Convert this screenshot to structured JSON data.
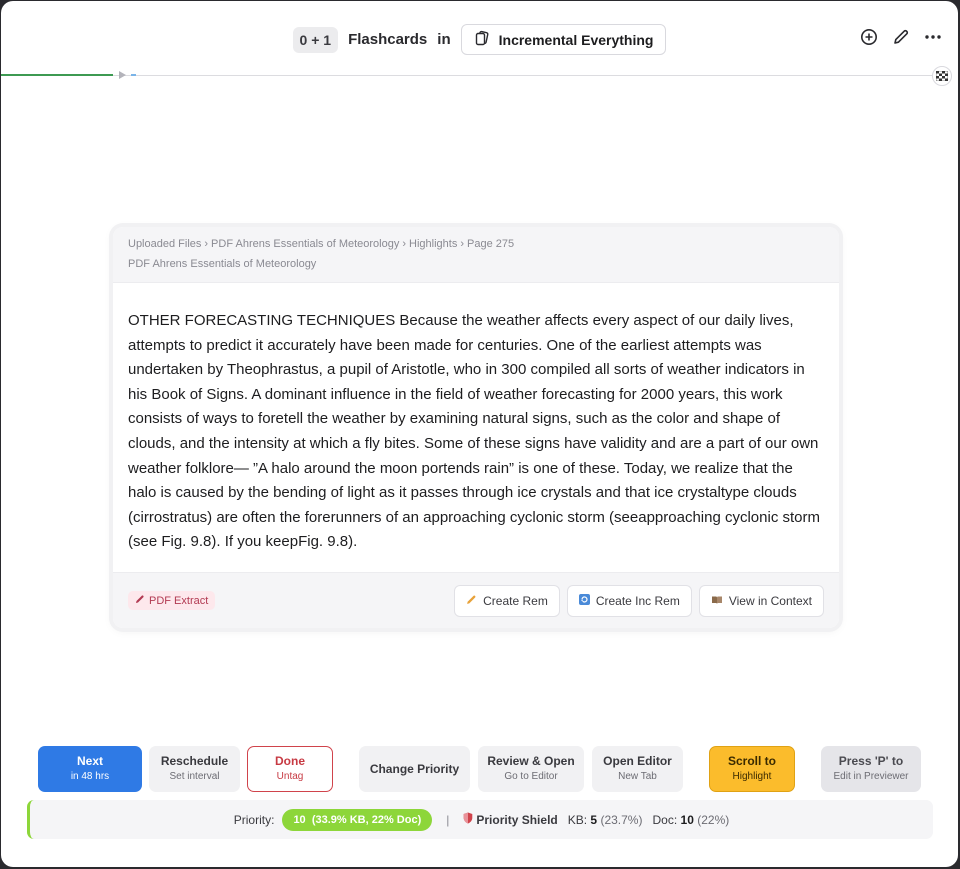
{
  "header": {
    "count": "0 + 1",
    "title": "Flashcards",
    "in_text": "in",
    "deck_name": "Incremental Everything",
    "actions": [
      "add-icon",
      "edit-icon",
      "more-icon"
    ]
  },
  "progress": {
    "completed_fraction": 0.12
  },
  "card": {
    "breadcrumb": [
      "Uploaded Files",
      "PDF Ahrens Essentials of Meteorology",
      "Highlights",
      "Page 275"
    ],
    "source": "PDF Ahrens Essentials of Meteorology",
    "body": "OTHER FORECASTING TECHNIQUES Because the weather affects every aspect of our daily lives, attempts to predict it accurately have been made for centuries. One of the earliest attempts was undertaken by Theophrastus, a pupil of Aristotle, who in 300    compiled all sorts of weather indicators in his Book of Signs. A dominant influence in the field of weather forecasting for 2000 years, this work consists of ways to foretell the weather by examining natural signs, such as the color and shape of clouds, and the intensity at which a fly bites. Some of these signs have validity and are a part of our own weather folklore— ”A halo around the moon portends rain” is one of these. Today, we realize that the halo is caused by the bending of light as it passes through ice crystals and that ice crystaltype clouds (cirrostratus) are often the forerunners of an approaching cyclonic storm (seeapproaching cyclonic storm (see Fig. 9.8). If you keepFig. 9.8).",
    "tag": "PDF Extract",
    "buttons": {
      "create_rem": "Create Rem",
      "create_inc_rem": "Create Inc Rem",
      "view_in_context": "View in Context"
    }
  },
  "actions": {
    "next": {
      "title": "Next",
      "sub": "in 48 hrs"
    },
    "reschedule": {
      "title": "Reschedule",
      "sub": "Set interval"
    },
    "done": {
      "title": "Done",
      "sub": "Untag"
    },
    "change_priority": {
      "title": "Change Priority"
    },
    "review_open": {
      "title": "Review & Open",
      "sub": "Go to Editor"
    },
    "open_editor": {
      "title": "Open Editor",
      "sub": "New Tab"
    },
    "scroll_to": {
      "title": "Scroll to",
      "sub": "Highlight"
    },
    "press_p": {
      "title": "Press 'P' to",
      "sub": "Edit in Previewer"
    }
  },
  "priority": {
    "label": "Priority:",
    "value": "10",
    "detail": "(33.9% KB, 22% Doc)",
    "divider": "|",
    "shield_label": "Priority Shield",
    "kb_label": "KB:",
    "kb_value": "5",
    "kb_pct": "(23.7%)",
    "doc_label": "Doc:",
    "doc_value": "10",
    "doc_pct": "(22%)"
  },
  "colors": {
    "accent_blue": "#2f7ae5",
    "done_red": "#c73a43",
    "scroll_yellow": "#fbbc2c",
    "priority_green": "#8dd63a",
    "progress_green": "#3d9a52"
  }
}
